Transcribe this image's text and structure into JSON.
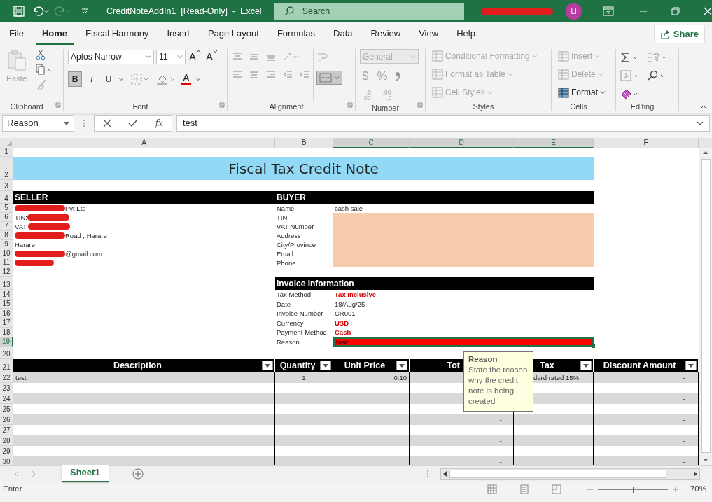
{
  "title_bar": {
    "title": "CreditNoteAddIn1  [Read-Only]  -  Excel",
    "search": {
      "placeholder": "Search"
    },
    "account": {
      "initials": "LI",
      "name_redacted": true
    }
  },
  "menu_tabs": [
    {
      "label": "File",
      "selected": false
    },
    {
      "label": "Home",
      "selected": true
    },
    {
      "label": "Fiscal Harmony",
      "selected": false
    },
    {
      "label": "Insert",
      "selected": false
    },
    {
      "label": "Page Layout",
      "selected": false
    },
    {
      "label": "Formulas",
      "selected": false
    },
    {
      "label": "Data",
      "selected": false
    },
    {
      "label": "Review",
      "selected": false
    },
    {
      "label": "View",
      "selected": false
    },
    {
      "label": "Help",
      "selected": false
    }
  ],
  "share_button": "Share",
  "ribbon": {
    "clipboard": {
      "label": "Clipboard",
      "paste": "Paste"
    },
    "font": {
      "label": "Font",
      "font_name": "Aptos Narrow",
      "font_size": "11",
      "size_buttons": [
        {
          "label": "A",
          "kind": "grow"
        },
        {
          "label": "A",
          "kind": "shrink"
        }
      ],
      "style_buttons": [
        {
          "label": "B",
          "selected": true
        },
        {
          "label": "I",
          "selected": false
        },
        {
          "label": "U",
          "selected": false
        }
      ],
      "font_color": {
        "label": "A",
        "color": "#e00000"
      }
    },
    "alignment": {
      "label": "Alignment",
      "merge_selected": true
    },
    "number": {
      "label": "Number",
      "format": "General",
      "disabled": true,
      "symbols": [
        "$",
        "%"
      ],
      "decimal_buttons": [
        {
          "top": ".0",
          "bottom": ".00",
          "kind": "increase"
        },
        {
          "top": ".00",
          "bottom": ".0",
          "kind": "decrease"
        }
      ]
    },
    "styles": {
      "label": "Styles",
      "items": [
        {
          "label": "Conditional Formatting",
          "disabled": true
        },
        {
          "label": "Format as Table",
          "disabled": true
        },
        {
          "label": "Cell Styles",
          "disabled": true
        }
      ]
    },
    "cells": {
      "label": "Cells",
      "items": [
        {
          "label": "Insert",
          "disabled": true
        },
        {
          "label": "Delete",
          "disabled": true
        },
        {
          "label": "Format",
          "disabled": false
        }
      ]
    },
    "editing": {
      "label": "Editing"
    }
  },
  "name_box": "Reason",
  "function_button": "fx",
  "formula": "test",
  "columns": [
    {
      "label": "A",
      "selected": false
    },
    {
      "label": "B",
      "selected": false
    },
    {
      "label": "C",
      "selected": true
    },
    {
      "label": "D",
      "selected": true
    },
    {
      "label": "E",
      "selected": true
    },
    {
      "label": "F",
      "selected": false
    }
  ],
  "row_headers": [
    {
      "label": "1",
      "selected": false
    },
    {
      "label": "2",
      "selected": false
    },
    {
      "label": "3",
      "selected": false
    },
    {
      "label": "4",
      "selected": false
    },
    {
      "label": "5",
      "selected": false
    },
    {
      "label": "6",
      "selected": false
    },
    {
      "label": "7",
      "selected": false
    },
    {
      "label": "8",
      "selected": false
    },
    {
      "label": "9",
      "selected": false
    },
    {
      "label": "10",
      "selected": false
    },
    {
      "label": "11",
      "selected": false
    },
    {
      "label": "12",
      "selected": false
    },
    {
      "label": "13",
      "selected": false
    },
    {
      "label": "14",
      "selected": false
    },
    {
      "label": "15",
      "selected": false
    },
    {
      "label": "16",
      "selected": false
    },
    {
      "label": "17",
      "selected": false
    },
    {
      "label": "18",
      "selected": false
    },
    {
      "label": "19",
      "selected": true
    },
    {
      "label": "20",
      "selected": false
    },
    {
      "label": "21",
      "selected": false
    },
    {
      "label": "22",
      "selected": false
    },
    {
      "label": "23",
      "selected": false
    },
    {
      "label": "24",
      "selected": false
    },
    {
      "label": "25",
      "selected": false
    },
    {
      "label": "26",
      "selected": false
    },
    {
      "label": "27",
      "selected": false
    },
    {
      "label": "28",
      "selected": false
    },
    {
      "label": "29",
      "selected": false
    },
    {
      "label": "30",
      "selected": false
    }
  ],
  "sheet": {
    "title": "Fiscal Tax Credit Note",
    "seller": {
      "heading": "SELLER",
      "lines": [
        {
          "text": "Pvt Ltd",
          "kind": "masked-start"
        },
        {
          "text": "TIN:",
          "kind": "masked-end"
        },
        {
          "text": "VAT: ",
          "kind": "masked-end"
        },
        {
          "text": "Road , Harare",
          "kind": "masked-start"
        },
        {
          "text": "Harare",
          "kind": "plain"
        },
        {
          "text": "@gmail.com",
          "kind": "masked-start"
        },
        {
          "kind": "masked"
        }
      ]
    },
    "buyer": {
      "heading": "BUYER",
      "fields": [
        {
          "label": "Name",
          "value": "cash sale",
          "highlighted": false
        },
        {
          "label": "TIN",
          "highlighted": true
        },
        {
          "label": "VAT Number",
          "highlighted": true
        },
        {
          "label": "Address",
          "highlighted": true
        },
        {
          "label": "City/Province",
          "highlighted": true
        },
        {
          "label": "Email",
          "highlighted": true
        },
        {
          "label": "Phone",
          "highlighted": true
        }
      ]
    },
    "invoice_info": {
      "heading": "Invoice Information",
      "fields": [
        {
          "label": "Tax Method",
          "value": "Tax Inclusive",
          "kind": "alert"
        },
        {
          "label": "Date",
          "value": "18/Aug/25",
          "kind": "plain"
        },
        {
          "label": "Invoice Number",
          "value": "CR001",
          "kind": "plain"
        },
        {
          "label": "Currency",
          "value": "USD",
          "kind": "alert"
        },
        {
          "label": "Payment Method",
          "value": "Cash",
          "kind": "alert"
        },
        {
          "label": "Reason",
          "value": "test",
          "kind": "filled",
          "selected": true
        }
      ]
    },
    "table": {
      "columns": [
        {
          "label": "Description",
          "filter": true
        },
        {
          "label": "Quantity",
          "filter": true
        },
        {
          "label": "Unit Price",
          "filter": true
        },
        {
          "label": "Tot"
        },
        {
          "label": "Tax",
          "filter": true
        },
        {
          "label": "Discount Amount",
          "filter": true
        }
      ],
      "rows": [
        {
          "description": "test",
          "quantity": "1",
          "unit_price": "0.10",
          "tax": "dard rated 15%",
          "discount": "-"
        },
        {
          "discount": "-"
        },
        {
          "discount": "-"
        },
        {
          "discount": "-"
        },
        {
          "total": "-",
          "discount": "-"
        },
        {
          "total": "-",
          "discount": "-"
        },
        {
          "total": "-",
          "discount": "-"
        },
        {
          "total": "-",
          "discount": "-"
        },
        {
          "total": "-",
          "discount": "-"
        }
      ]
    },
    "tooltip": {
      "title": "Reason",
      "text": "State the reason why the credit note is being created"
    }
  },
  "sheet_tabs": [
    {
      "label": "Sheet1",
      "selected": true
    }
  ],
  "status_bar": {
    "mode": "Enter",
    "zoom": {
      "label": "70%",
      "level": 0.5
    }
  }
}
